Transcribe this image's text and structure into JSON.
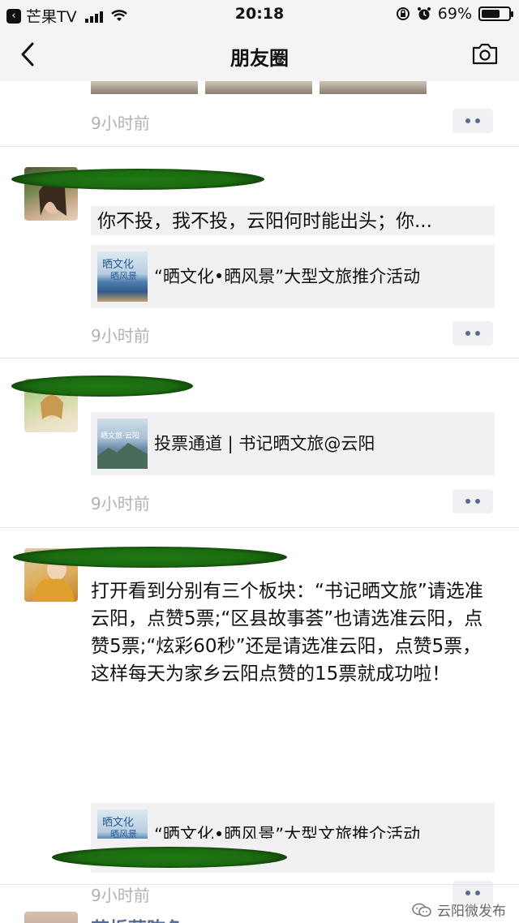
{
  "status_bar": {
    "carrier": "芒果TV",
    "time": "20:18",
    "battery": "69%",
    "battery_level": 0.69,
    "icons": [
      "back-to-app-icon",
      "signal-icon",
      "wifi-icon",
      "orientation-lock-icon",
      "alarm-icon",
      "battery-icon"
    ]
  },
  "nav": {
    "title": "朋友圈",
    "back_icon": "chevron-left-icon",
    "camera_icon": "camera-icon"
  },
  "posts": [
    {
      "time": "9小时前"
    },
    {
      "text": "你不投，我不投，云阳何时能出头；你...",
      "link_title": "“晒文化•晒风景”大型文旅推介活动",
      "time": "9小时前"
    },
    {
      "link_title": "投票通道 | 书记晒文旅@云阳",
      "time": "9小时前"
    },
    {
      "text": "打开看到分别有三个板块：“书记晒文旅”请选准云阳，点赞5票;“区县故事荟”也请选准云阳，点赞5票;“炫彩60秒”还是请选准云阳，点赞5票，这样每天为家乡云阳点赞的15票就成功啦！",
      "link_title": "“晒文化•晒风景”大型文旅推介活动",
      "time": "9小时前"
    },
    {
      "partial_name": "艾栎菲陈色"
    }
  ],
  "watermark": {
    "text": "云阳微发布",
    "icon": "wechat-official-account-icon"
  }
}
